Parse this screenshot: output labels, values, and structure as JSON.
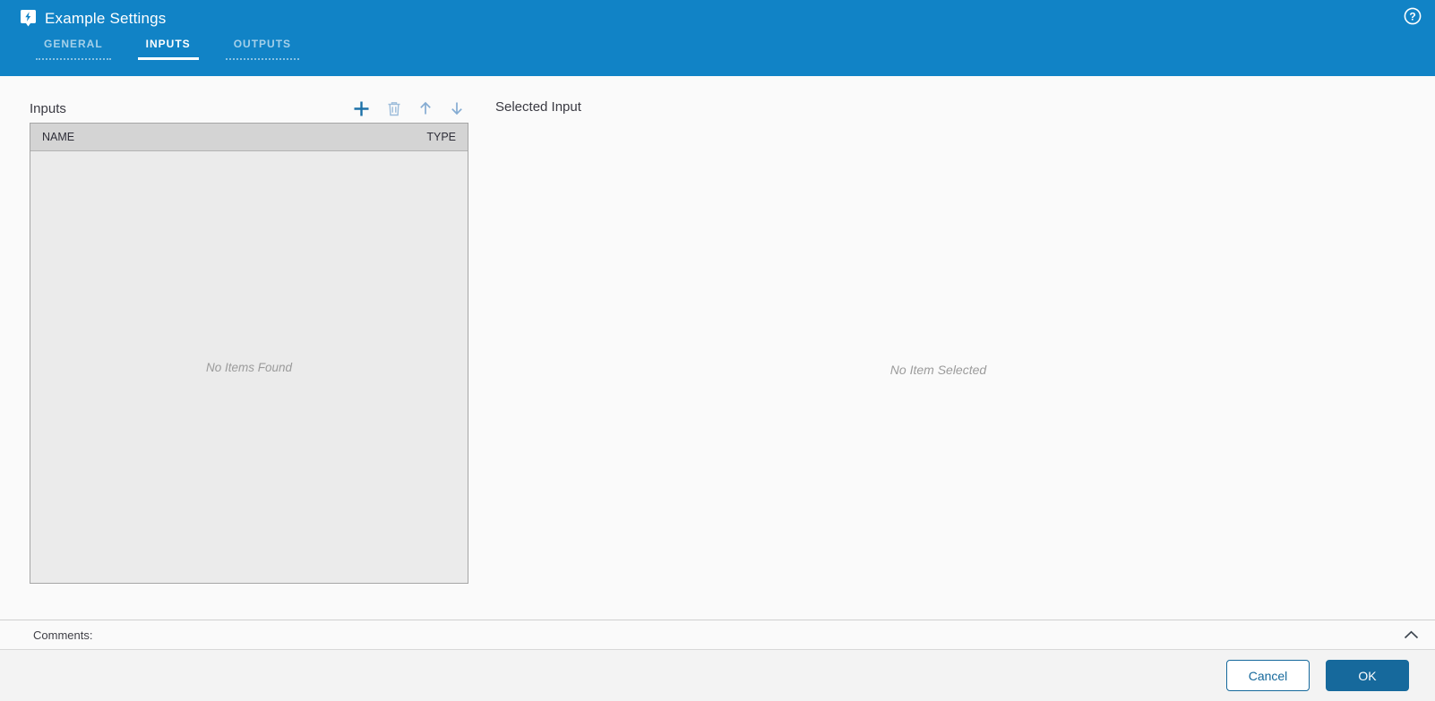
{
  "header": {
    "title": "Example Settings",
    "title_icon": "tag-bolt-icon",
    "help_icon": "help-icon",
    "tabs": [
      {
        "label": "GENERAL",
        "active": false
      },
      {
        "label": "INPUTS",
        "active": true
      },
      {
        "label": "OUTPUTS",
        "active": false
      }
    ]
  },
  "inputs_panel": {
    "title": "Inputs",
    "toolbar": [
      {
        "icon": "plus-icon",
        "action": "add",
        "enabled": true
      },
      {
        "icon": "trash-icon",
        "action": "delete",
        "enabled": false
      },
      {
        "icon": "arrow-up-icon",
        "action": "move-up",
        "enabled": false
      },
      {
        "icon": "arrow-down-icon",
        "action": "move-down",
        "enabled": false
      }
    ],
    "table": {
      "columns": {
        "0": "NAME",
        "1": "TYPE"
      },
      "rows": [],
      "empty_text": "No Items Found"
    }
  },
  "selected_panel": {
    "title": "Selected Input",
    "empty_text": "No Item Selected"
  },
  "comments": {
    "label": "Comments:",
    "collapse_icon": "chevron-up-icon",
    "expanded": true
  },
  "footer": {
    "cancel_label": "Cancel",
    "ok_label": "OK"
  },
  "colors": {
    "header_background": "#1183c6",
    "accent": "#16699c",
    "table_header_background": "#d4d4d4",
    "table_body_background": "#ebebeb",
    "empty_text": "#9b9b9b",
    "enabled_icon": "#1c71a8",
    "disabled_icon": "#9cbcda"
  }
}
